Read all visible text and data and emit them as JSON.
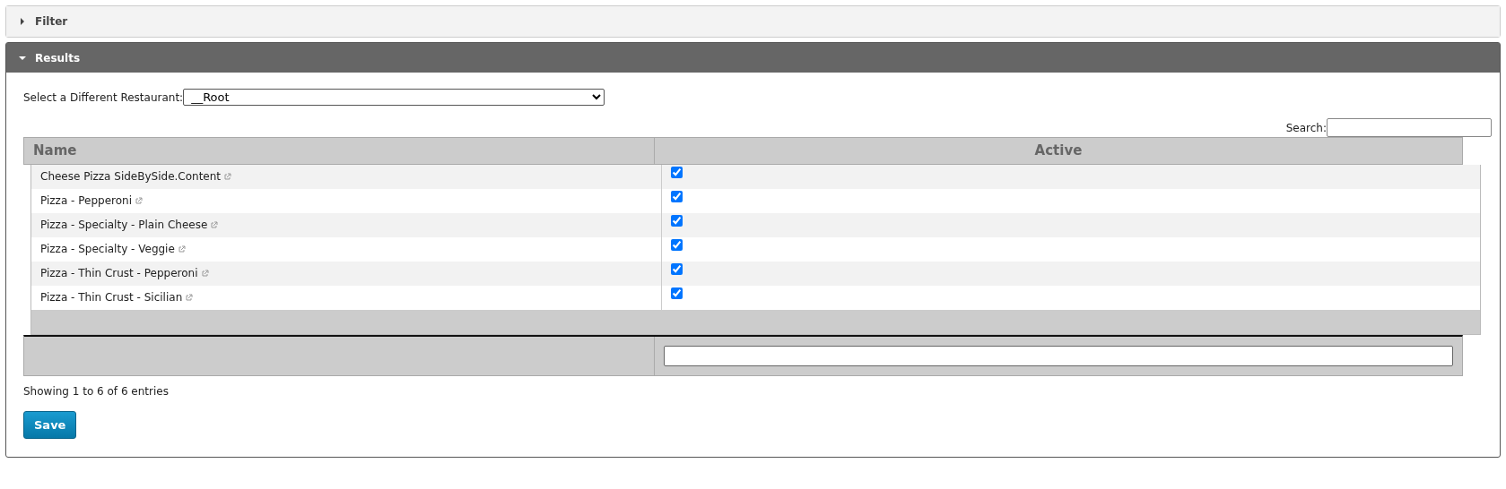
{
  "panels": [
    {
      "title": "Filter",
      "expanded": false
    },
    {
      "title": "Results",
      "expanded": true
    }
  ],
  "restaurant_select": {
    "label": "Select a Different Restaurant:",
    "value": "__Root"
  },
  "search": {
    "label": "Search:"
  },
  "table": {
    "columns": [
      "Name",
      "Active"
    ],
    "rows": [
      {
        "name": "Cheese Pizza SideBySide.Content",
        "active": true
      },
      {
        "name": "Pizza - Pepperoni",
        "active": true
      },
      {
        "name": "Pizza - Specialty - Plain Cheese",
        "active": true
      },
      {
        "name": "Pizza - Specialty - Veggie",
        "active": true
      },
      {
        "name": "Pizza - Thin Crust - Pepperoni",
        "active": true
      },
      {
        "name": "Pizza - Thin Crust - Sicilian",
        "active": true
      }
    ]
  },
  "info": "Showing 1 to 6 of 6 entries",
  "save_button": "Save"
}
